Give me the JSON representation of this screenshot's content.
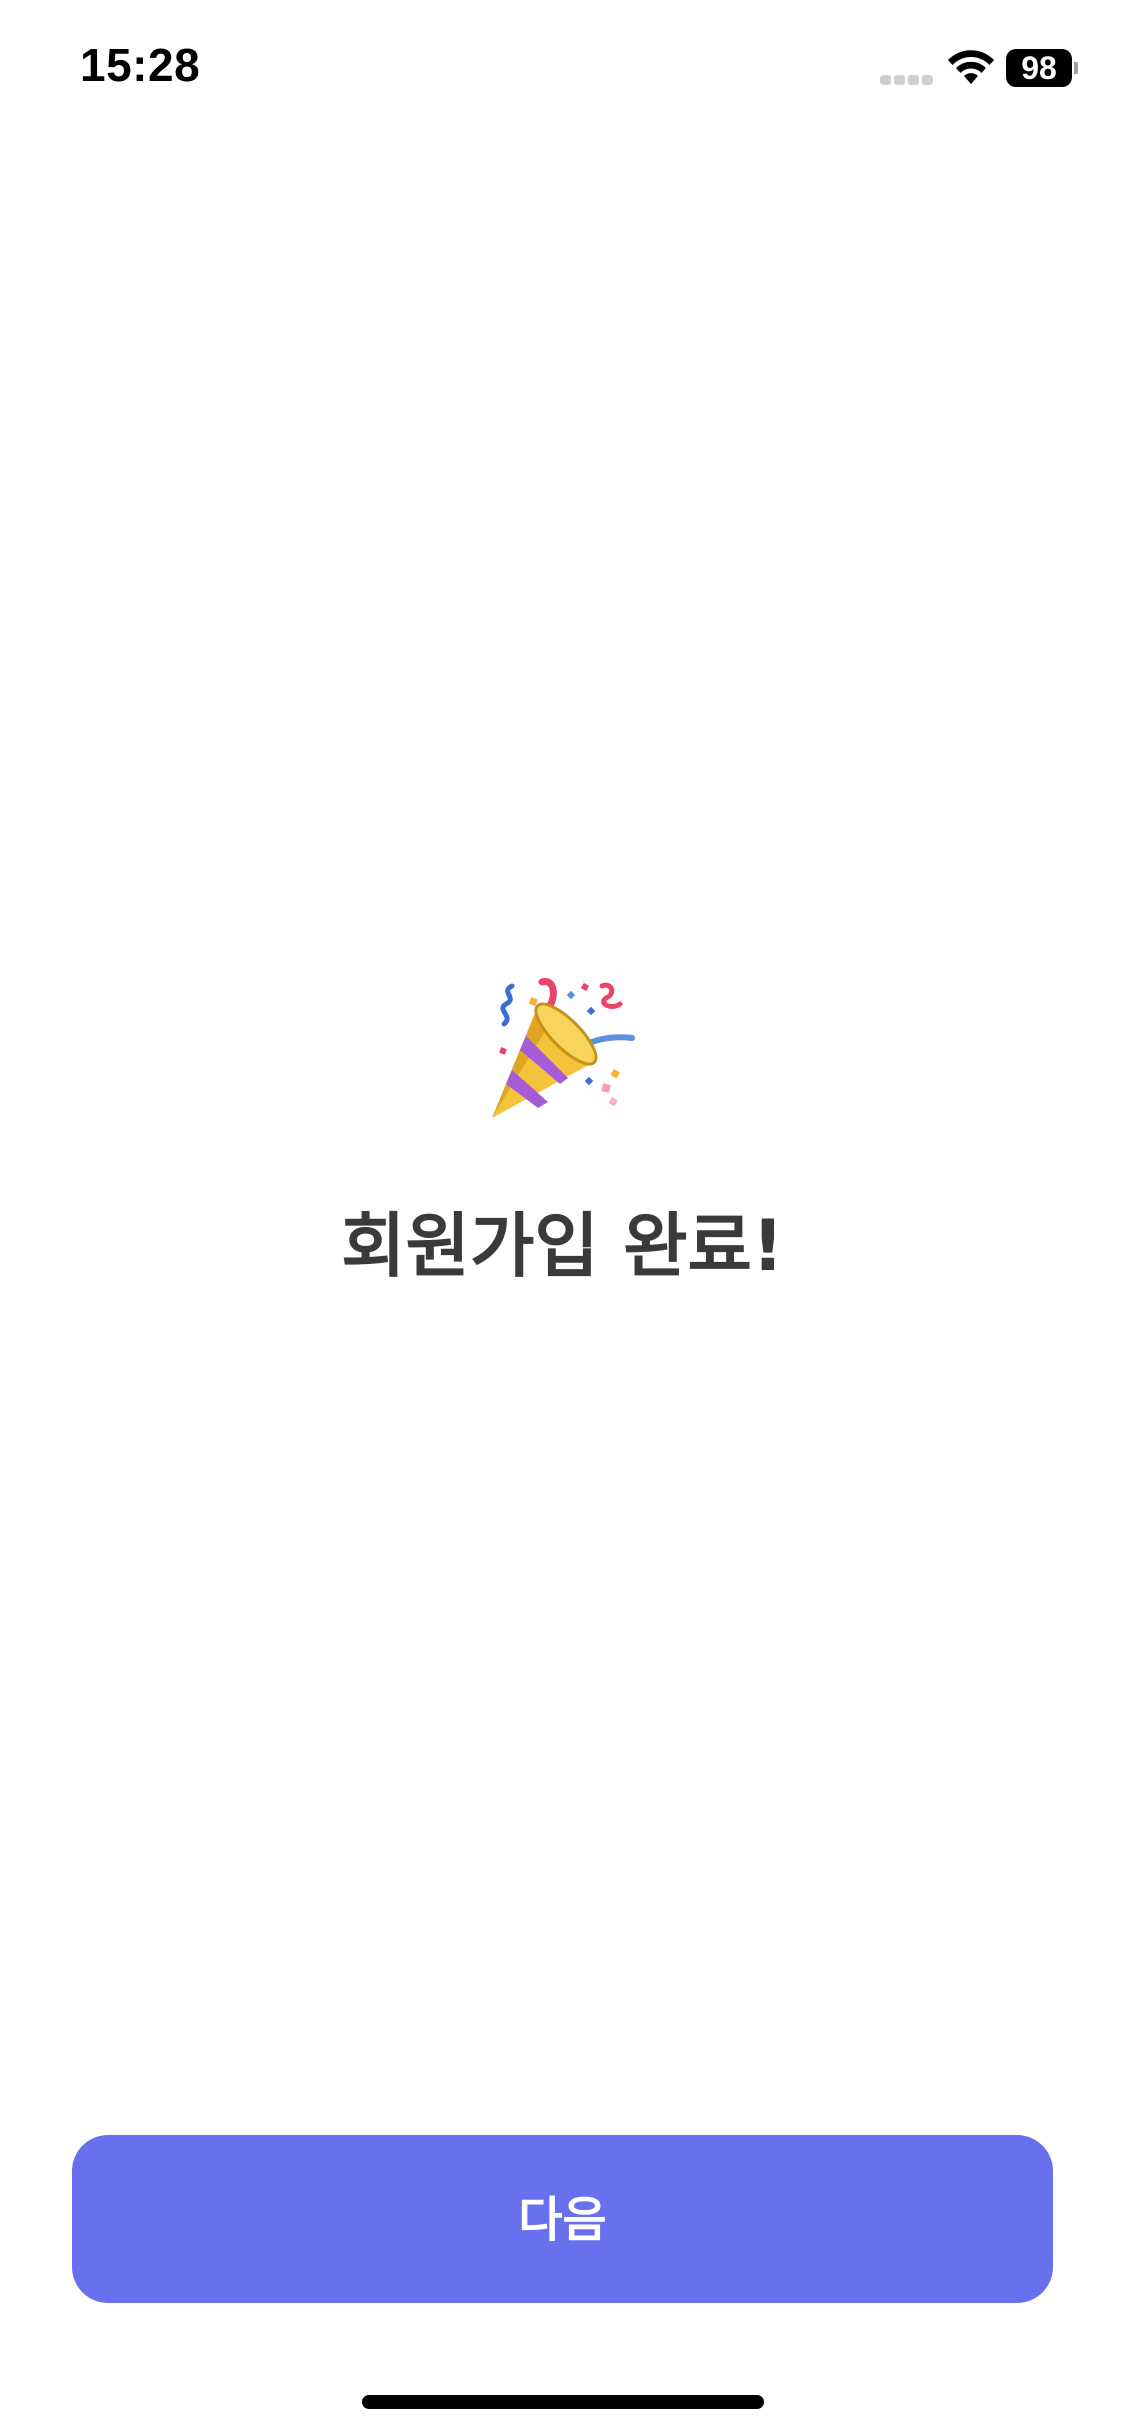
{
  "status_bar": {
    "time": "15:28",
    "battery_level": "98"
  },
  "icons": {
    "celebration": "party-popper-icon",
    "wifi": "wifi-icon",
    "signal": "cellular-signal-icon",
    "battery": "battery-icon"
  },
  "main": {
    "title": "회원가입 완료!"
  },
  "footer": {
    "next_label": "다음"
  },
  "colors": {
    "button_background": "#6870ee",
    "title_text": "#3a3a3a",
    "background": "#ffffff"
  }
}
